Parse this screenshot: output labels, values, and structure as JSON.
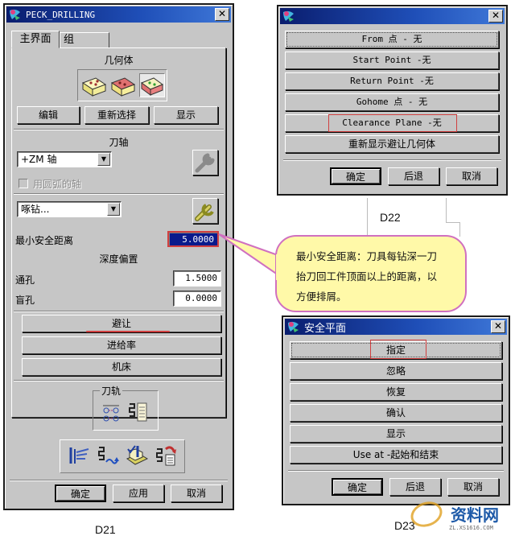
{
  "d21": {
    "title": "PECK_DRILLING",
    "tabs": [
      "主界面",
      "组"
    ],
    "geometry_label": "几何体",
    "geometry_buttons": [
      "编辑",
      "重新选择",
      "显示"
    ],
    "tool_axis_label": "刀轴",
    "tool_axis_value": "+ZM 轴",
    "arc_axis_checkbox": {
      "label": "用圆弧的轴",
      "checked": false,
      "enabled": false
    },
    "cycle_value": "啄钻...",
    "min_clearance_label": "最小安全距离",
    "min_clearance_value": "5.0000",
    "depth_offset_label": "深度偏置",
    "through_hole_label": "通孔",
    "through_hole_value": "1.5000",
    "blind_hole_label": "盲孔",
    "blind_hole_value": "0.0000",
    "buttons": [
      "避让",
      "进给率",
      "机床"
    ],
    "toolpath_label": "刀轨",
    "footer_buttons": [
      "确定",
      "应用",
      "取消"
    ],
    "caption": "D21"
  },
  "d22": {
    "title": "",
    "items": [
      "From 点 - 无",
      "Start Point -无",
      "Return Point -无",
      "Gohome 点 - 无",
      "Clearance Plane -无",
      "重新显示避让几何体"
    ],
    "footer_buttons": [
      "确定",
      "后退",
      "取消"
    ],
    "caption": "D22"
  },
  "callout": {
    "line1": "最小安全距离：刀具每钻深一刀",
    "line2": "抬刀回工件顶面以上的距离，以",
    "line3": "方便排屑。"
  },
  "d23": {
    "title": "安全平面",
    "items": [
      "指定",
      "忽略",
      "恢复",
      "确认",
      "显示",
      "Use at -起始和结束"
    ],
    "footer_buttons": [
      "确定",
      "后退",
      "取消"
    ],
    "caption": "D23"
  },
  "watermark": "资料网",
  "watermark_url": "ZL.XS1616.COM",
  "annotation_color": "#d04040"
}
